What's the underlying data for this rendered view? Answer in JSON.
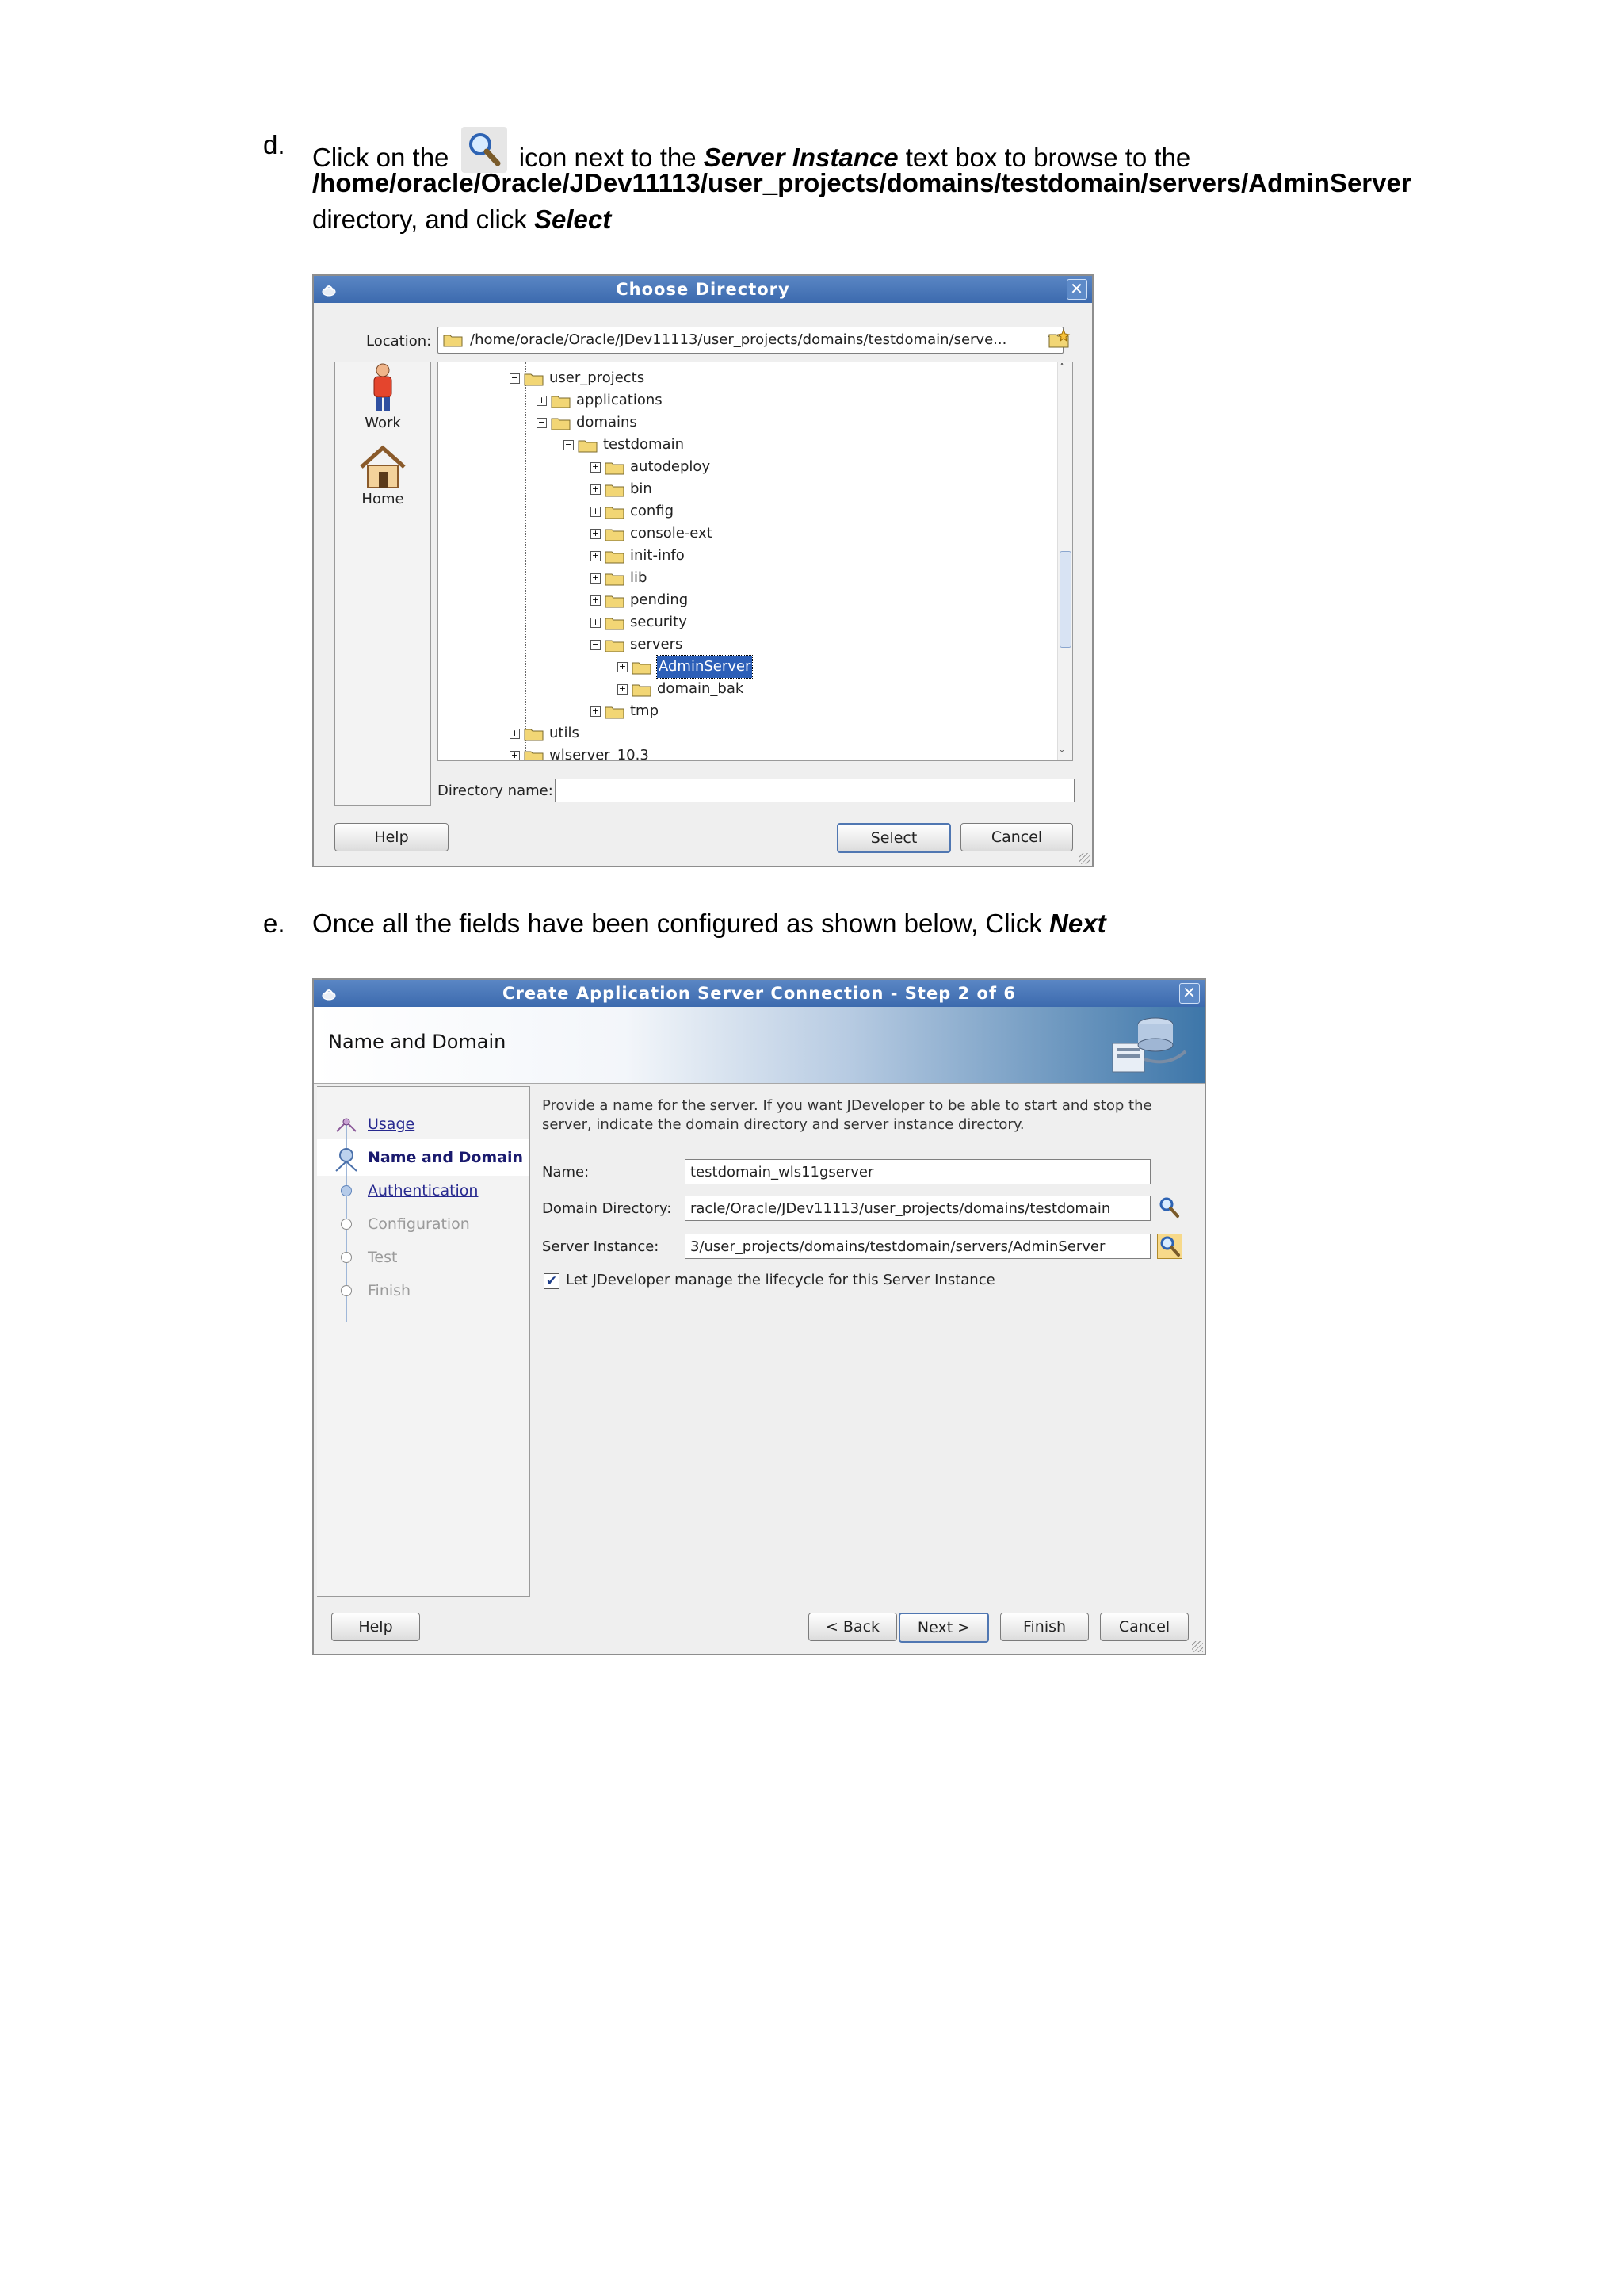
{
  "step_d": {
    "marker": "d.",
    "line1_before": "Click on the",
    "line1_after": "icon next to the",
    "field_name": "Server Instance",
    "line1_end": "text box to browse to the",
    "path": "/home/oracle/Oracle/JDev11113/user_projects/domains/testdomain/servers/AdminServer",
    "line3_start": "directory, and click",
    "action": "Select"
  },
  "step_e": {
    "marker": "e.",
    "text": "Once all the fields have been configured as shown below, Click",
    "action": "Next"
  },
  "choose_directory": {
    "title": "Choose Directory",
    "location_label": "Location:",
    "location_value": "/home/oracle/Oracle/JDev11113/user_projects/domains/testdomain/serve...",
    "places": [
      {
        "label": "Work",
        "icon": "work-person-icon"
      },
      {
        "label": "Home",
        "icon": "home-icon"
      }
    ],
    "tree": [
      {
        "label": "user_projects",
        "level": 0,
        "expanded": true
      },
      {
        "label": "applications",
        "level": 1,
        "expanded": false
      },
      {
        "label": "domains",
        "level": 1,
        "expanded": true
      },
      {
        "label": "testdomain",
        "level": 2,
        "expanded": true
      },
      {
        "label": "autodeploy",
        "level": 3,
        "expanded": false
      },
      {
        "label": "bin",
        "level": 3,
        "expanded": false
      },
      {
        "label": "config",
        "level": 3,
        "expanded": false
      },
      {
        "label": "console-ext",
        "level": 3,
        "expanded": false
      },
      {
        "label": "init-info",
        "level": 3,
        "expanded": false
      },
      {
        "label": "lib",
        "level": 3,
        "expanded": false
      },
      {
        "label": "pending",
        "level": 3,
        "expanded": false
      },
      {
        "label": "security",
        "level": 3,
        "expanded": false
      },
      {
        "label": "servers",
        "level": 3,
        "expanded": true
      },
      {
        "label": "AdminServer",
        "level": 4,
        "expanded": false,
        "selected": true
      },
      {
        "label": "domain_bak",
        "level": 4,
        "expanded": false
      },
      {
        "label": "tmp",
        "level": 3,
        "expanded": false
      },
      {
        "label": "utils",
        "level": 0,
        "expanded": false
      },
      {
        "label": "wlserver_10.3",
        "level": 0,
        "expanded": false
      }
    ],
    "directory_name_label": "Directory name:",
    "directory_name_value": "",
    "help_label": "Help",
    "select_label": "Select",
    "cancel_label": "Cancel"
  },
  "wizard": {
    "title": "Create Application Server Connection - Step 2 of 6",
    "header": "Name and Domain",
    "steps": [
      {
        "label": "Usage",
        "state": "link"
      },
      {
        "label": "Name and Domain",
        "state": "current"
      },
      {
        "label": "Authentication",
        "state": "link"
      },
      {
        "label": "Configuration",
        "state": "disabled"
      },
      {
        "label": "Test",
        "state": "disabled"
      },
      {
        "label": "Finish",
        "state": "disabled"
      }
    ],
    "description_line1": "Provide a name for the server. If you want JDeveloper to be able to start and stop the",
    "description_line2": "server, indicate the domain directory and server instance directory.",
    "name_label": "Name:",
    "name_value": "testdomain_wls11gserver",
    "domain_dir_label": "Domain Directory:",
    "domain_dir_value": "racle/Oracle/JDev11113/user_projects/domains/testdomain",
    "server_instance_label": "Server Instance:",
    "server_instance_value": "3/user_projects/domains/testdomain/servers/AdminServer",
    "manage_lifecycle_label": "Let JDeveloper manage the lifecycle for this Server Instance",
    "manage_lifecycle_checked": true,
    "help_label": "Help",
    "back_label": "< Back",
    "next_label": "Next >",
    "finish_label": "Finish",
    "cancel_label": "Cancel"
  }
}
